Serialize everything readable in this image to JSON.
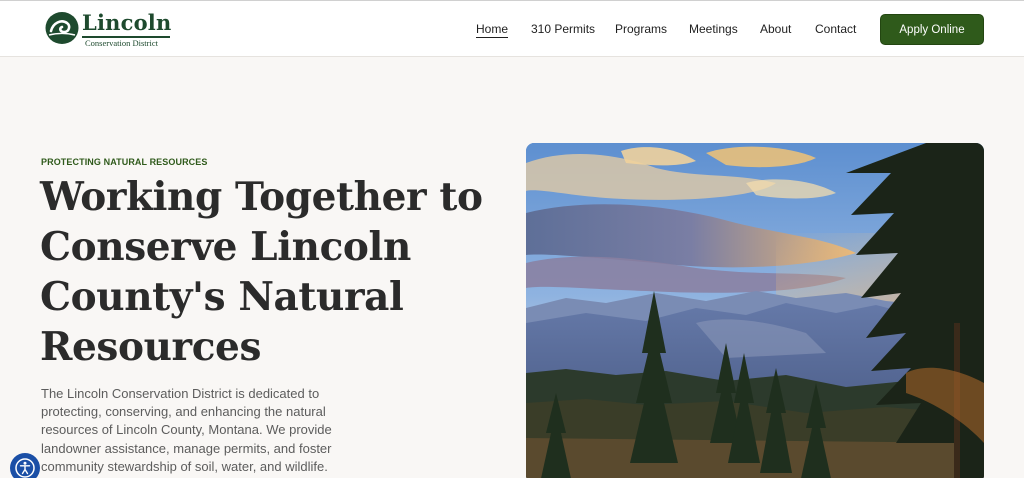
{
  "header": {
    "logo": {
      "name": "Lincoln",
      "subtitle": "Conservation District"
    },
    "nav": [
      {
        "label": "Home",
        "active": true
      },
      {
        "label": "310 Permits",
        "active": false
      },
      {
        "label": "Programs",
        "active": false
      },
      {
        "label": "Meetings",
        "active": false
      },
      {
        "label": "About",
        "active": false
      },
      {
        "label": "Contact",
        "active": false
      }
    ],
    "cta_label": "Apply Online"
  },
  "hero": {
    "eyebrow": "PROTECTING NATURAL RESOURCES",
    "title": "Working Together to Conserve Lincoln County's Natural Resources",
    "description": "The Lincoln Conservation District is dedicated to protecting, conserving, and enhancing the natural resources of Lincoln County, Montana. We provide landowner assistance, manage permits, and foster community stewardship of soil, water, and wildlife.",
    "image_subject": "mountain-forest-landscape"
  },
  "accessibility_widget": {
    "icon": "accessibility-icon"
  },
  "colors": {
    "brand_green": "#2f5a1b",
    "logo_green": "#1e4a2e",
    "background": "#f9f7f5",
    "heading": "#2b2b2b",
    "body_text": "#5c5c5c",
    "a11y_blue": "#1b4fa6"
  }
}
